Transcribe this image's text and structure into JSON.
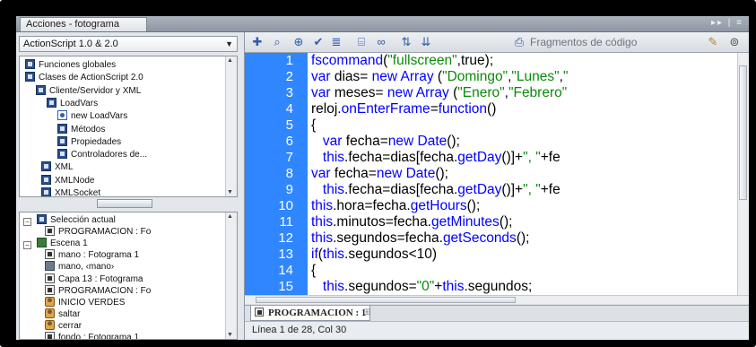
{
  "window": {
    "title": "Acciones - fotograma",
    "controls": "▸▸ | ≡"
  },
  "left_panel": {
    "version_select": "ActionScript 1.0 & 2.0",
    "library_tree": [
      {
        "label": "Funciones globales",
        "icon": "book-icon"
      },
      {
        "label": "Clases de ActionScript 2.0",
        "icon": "book-icon"
      },
      {
        "label": "Cliente/Servidor y XML",
        "icon": "book-icon"
      },
      {
        "label": "LoadVars",
        "icon": "book-icon"
      },
      {
        "label": "new LoadVars",
        "icon": "method-icon"
      },
      {
        "label": "Métodos",
        "icon": "book-icon"
      },
      {
        "label": "Propiedades",
        "icon": "book-icon"
      },
      {
        "label": "Controladores de...",
        "icon": "book-icon"
      },
      {
        "label": "XML",
        "icon": "book-icon"
      },
      {
        "label": "XMLNode",
        "icon": "book-icon"
      },
      {
        "label": "XMLSocket",
        "icon": "book-icon"
      }
    ],
    "scene_tree": [
      {
        "label": "Selección actual",
        "icon": "book-icon"
      },
      {
        "label": "PROGRAMACION : Fo",
        "icon": "frame-icon"
      },
      {
        "label": "Escena 1",
        "icon": "scene-icon"
      },
      {
        "label": "mano : Fotograma 1",
        "icon": "frame-icon"
      },
      {
        "label": "mano, ‹mano›",
        "icon": "movieclip-icon"
      },
      {
        "label": "Capa 13 : Fotograma",
        "icon": "frame-icon"
      },
      {
        "label": "PROGRAMACION : Fo",
        "icon": "frame-icon"
      },
      {
        "label": "INICIO VERDES",
        "icon": "button-icon"
      },
      {
        "label": "saltar",
        "icon": "button-icon"
      },
      {
        "label": "cerrar",
        "icon": "button-icon"
      },
      {
        "label": "fondo : Fotograma 1",
        "icon": "frame-icon"
      }
    ]
  },
  "toolbar": {
    "fragment_label": "Fragmentos de código",
    "icons": [
      "add-statement-icon",
      "find-icon",
      "target-icon",
      "check-syntax-icon",
      "auto-format-icon",
      "code-hint-icon",
      "debug-options-icon",
      "collapse-icon",
      "expand-icon",
      "fragments-icon",
      "wand-icon",
      "help-icon"
    ]
  },
  "editor": {
    "lines": [
      {
        "num": "1",
        "code": "fscommand(\"fullscreen\",true);"
      },
      {
        "num": "2",
        "code": "var dias= new Array (\"Domingo\",\"Lunes\",\""
      },
      {
        "num": "3",
        "code": "var meses= new Array (\"Enero\",\"Febrero\""
      },
      {
        "num": "4",
        "code": "reloj.onEnterFrame=function()"
      },
      {
        "num": "5",
        "code": "{"
      },
      {
        "num": "6",
        "code": "   var fecha=new Date();"
      },
      {
        "num": "7",
        "code": "   this.fecha=dias[fecha.getDay()]+\", \"+fe"
      },
      {
        "num": "8",
        "code": "var fecha=new Date();"
      },
      {
        "num": "9",
        "code": "   this.fecha=dias[fecha.getDay()]+\", \"+fe"
      },
      {
        "num": "10",
        "code": "this.hora=fecha.getHours();"
      },
      {
        "num": "11",
        "code": "this.minutos=fecha.getMinutes();"
      },
      {
        "num": "12",
        "code": "this.segundos=fecha.getSeconds();"
      },
      {
        "num": "13",
        "code": "if(this.segundos<10)"
      },
      {
        "num": "14",
        "code": "{"
      },
      {
        "num": "15",
        "code": "   this.segundos=\"0\"+this.segundos;"
      }
    ],
    "tab_label": "PROGRAMACION : 1",
    "status": "Línea 1 de 28, Col 30"
  },
  "colors": {
    "gutter": "#2f86ff",
    "keyword": "#0000ff",
    "string": "#0a8a0a"
  }
}
